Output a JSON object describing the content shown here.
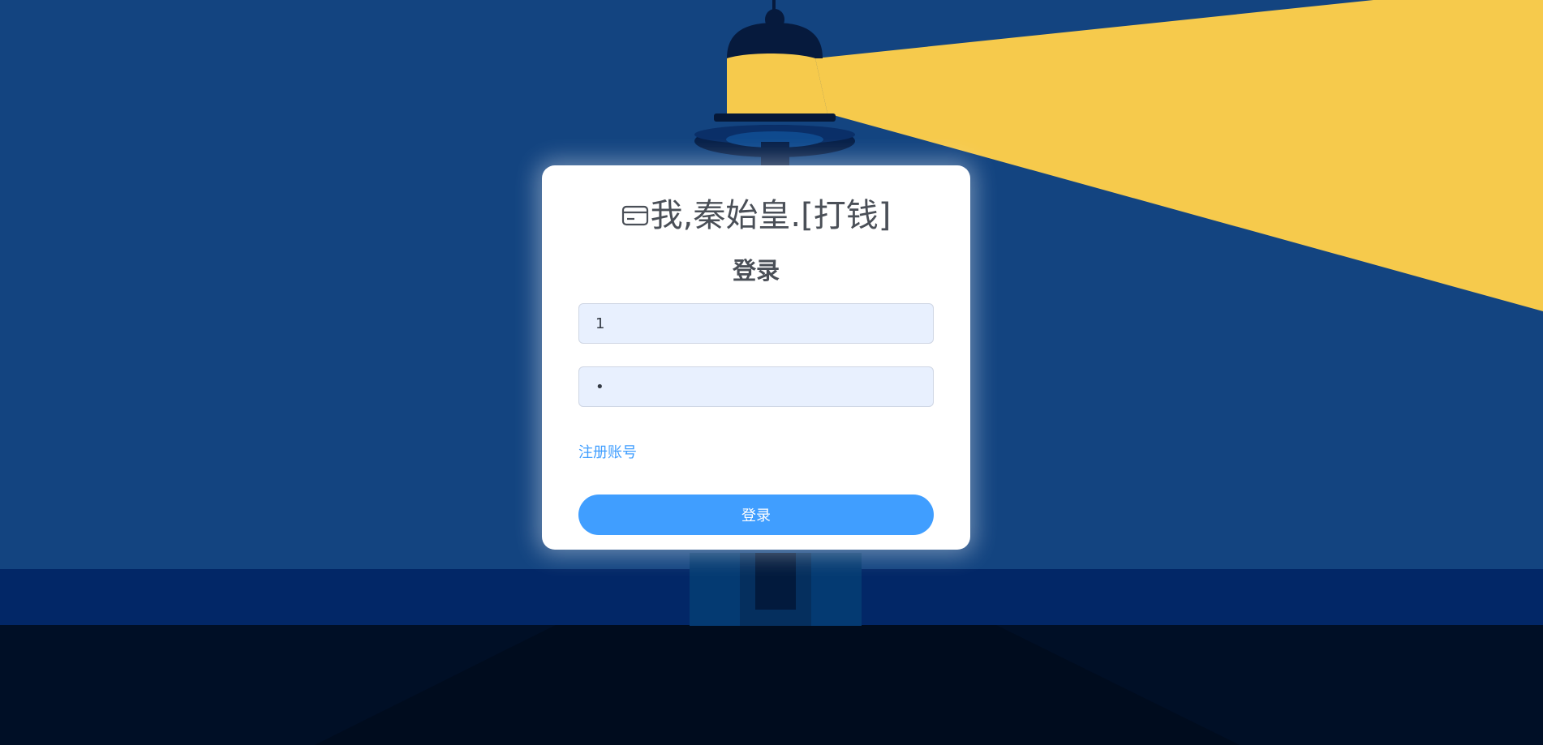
{
  "brand": {
    "text": "我,秦始皇.[打钱]",
    "icon": "credit-card-icon"
  },
  "login_form": {
    "title": "登录",
    "username_value": "1",
    "password_value": "•",
    "register_link": "注册账号",
    "submit_label": "登录"
  },
  "colors": {
    "sky": "#134480",
    "sea": "#022767",
    "ground": "#000f26",
    "beam": "#f6ca4c",
    "accent": "#409eff",
    "input_bg": "#e8f0fe"
  }
}
